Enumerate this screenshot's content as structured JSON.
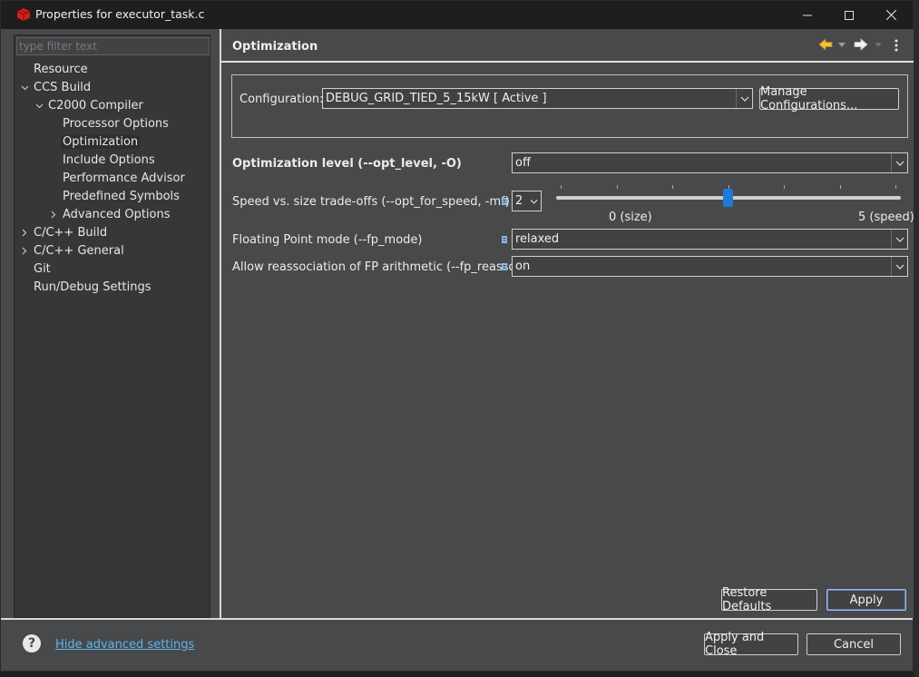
{
  "window": {
    "title": "Properties for executor_task.c",
    "colors": {
      "accent": "#1e7ad8",
      "link": "#5eb4e8",
      "panel": "#47494b",
      "tree_bg": "#353739"
    }
  },
  "titlebar": {
    "app_icon": "ccs-cube-icon",
    "minimize_icon": "minimize-icon",
    "maximize_icon": "maximize-icon",
    "close_icon": "close-icon"
  },
  "filter": {
    "placeholder": "type filter text",
    "value": ""
  },
  "tree": {
    "items": [
      {
        "label": "Resource"
      },
      {
        "label": "CCS Build"
      },
      {
        "label": "C2000 Compiler"
      },
      {
        "label": "Processor Options"
      },
      {
        "label": "Optimization"
      },
      {
        "label": "Include Options"
      },
      {
        "label": "Performance Advisor"
      },
      {
        "label": "Predefined Symbols"
      },
      {
        "label": "Advanced Options"
      },
      {
        "label": "C/C++ Build"
      },
      {
        "label": "C/C++ General"
      },
      {
        "label": "Git"
      },
      {
        "label": "Run/Debug Settings"
      }
    ]
  },
  "page": {
    "title": "Optimization",
    "configuration": {
      "label": "Configuration:",
      "value": "DEBUG_GRID_TIED_5_15kW  [ Active ]",
      "manage_button": "Manage Configurations..."
    },
    "opt_level": {
      "label": "Optimization level (--opt_level, -O)",
      "value": "off"
    },
    "speed_size": {
      "label": "Speed vs. size trade-offs (--opt_for_speed, -mf)",
      "value": "2",
      "min_label": "0 (size)",
      "max_label": "5 (speed)",
      "slider_value": 2,
      "slider_max": 5
    },
    "fp_mode": {
      "label": "Floating Point mode (--fp_mode)",
      "value": "relaxed"
    },
    "fp_reassoc": {
      "label": "Allow reassociation of FP arithmetic (--fp_reassoc)",
      "value": "on"
    },
    "restore_defaults": "Restore Defaults",
    "apply": "Apply"
  },
  "footer": {
    "help_glyph": "?",
    "hide_advanced": "Hide advanced settings",
    "apply_close": "Apply and Close",
    "cancel": "Cancel"
  }
}
